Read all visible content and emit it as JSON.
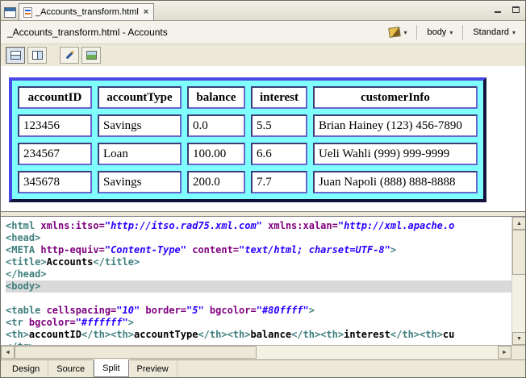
{
  "colors": {
    "table_bg": "#80ffff",
    "token_tag": "#3f7f7f",
    "token_attr": "#7f007f",
    "token_value": "#2a00ff"
  },
  "editor_tab": {
    "title": "_Accounts_transform.html"
  },
  "header": {
    "breadcrumb": "_Accounts_transform.html - Accounts",
    "element_selector": "body",
    "style_selector": "Standard"
  },
  "design": {
    "table": {
      "headers": [
        "accountID",
        "accountType",
        "balance",
        "interest",
        "customerInfo"
      ],
      "rows": [
        [
          "123456",
          "Savings",
          "0.0",
          "5.5",
          "Brian Hainey (123) 456-7890"
        ],
        [
          "234567",
          "Loan",
          "100.00",
          "6.6",
          "Ueli Wahli (999) 999-9999"
        ],
        [
          "345678",
          "Savings",
          "200.0",
          "7.7",
          "Juan Napoli (888) 888-8888"
        ]
      ]
    }
  },
  "source": {
    "lines": [
      {
        "hl": false,
        "segs": [
          [
            "tag",
            "<html "
          ],
          [
            "attr",
            "xmlns:itso="
          ],
          [
            "val",
            "\"http://itso.rad75.xml.com\""
          ],
          [
            "plain",
            " "
          ],
          [
            "attr",
            "xmlns:xalan="
          ],
          [
            "val",
            "\"http://xml.apache.o"
          ]
        ]
      },
      {
        "hl": false,
        "segs": [
          [
            "tag",
            "<head>"
          ]
        ]
      },
      {
        "hl": false,
        "segs": [
          [
            "tag",
            "<META "
          ],
          [
            "attr",
            "http-equiv="
          ],
          [
            "val",
            "\"Content-Type\""
          ],
          [
            "plain",
            " "
          ],
          [
            "attr",
            "content="
          ],
          [
            "val",
            "\"text/html; charset=UTF-8\""
          ],
          [
            "tag",
            ">"
          ]
        ]
      },
      {
        "hl": false,
        "segs": [
          [
            "tag",
            "<title>"
          ],
          [
            "txt",
            "Accounts"
          ],
          [
            "tag",
            "</title>"
          ]
        ]
      },
      {
        "hl": false,
        "segs": [
          [
            "tag",
            "</head>"
          ]
        ]
      },
      {
        "hl": true,
        "segs": [
          [
            "tag",
            "<body>"
          ]
        ]
      },
      {
        "hl": false,
        "segs": []
      },
      {
        "hl": false,
        "segs": [
          [
            "tag",
            "<table "
          ],
          [
            "attr",
            "cellspacing="
          ],
          [
            "val",
            "\"10\""
          ],
          [
            "plain",
            " "
          ],
          [
            "attr",
            "border="
          ],
          [
            "val",
            "\"5\""
          ],
          [
            "plain",
            " "
          ],
          [
            "attr",
            "bgcolor="
          ],
          [
            "val",
            "\"#80ffff\""
          ],
          [
            "tag",
            ">"
          ]
        ]
      },
      {
        "hl": false,
        "segs": [
          [
            "tag",
            "<tr "
          ],
          [
            "attr",
            "bgcolor="
          ],
          [
            "val",
            "\"#ffffff\""
          ],
          [
            "tag",
            ">"
          ]
        ]
      },
      {
        "hl": false,
        "segs": [
          [
            "tag",
            "<th>"
          ],
          [
            "txt",
            "accountID"
          ],
          [
            "tag",
            "</th><th>"
          ],
          [
            "txt",
            "accountType"
          ],
          [
            "tag",
            "</th><th>"
          ],
          [
            "txt",
            "balance"
          ],
          [
            "tag",
            "</th><th>"
          ],
          [
            "txt",
            "interest"
          ],
          [
            "tag",
            "</th><th>"
          ],
          [
            "txt",
            "cu"
          ]
        ]
      },
      {
        "hl": false,
        "segs": [
          [
            "tag",
            "</tr>"
          ]
        ]
      }
    ]
  },
  "bottom_tabs": {
    "items": [
      "Design",
      "Source",
      "Split",
      "Preview"
    ],
    "active": "Split"
  }
}
